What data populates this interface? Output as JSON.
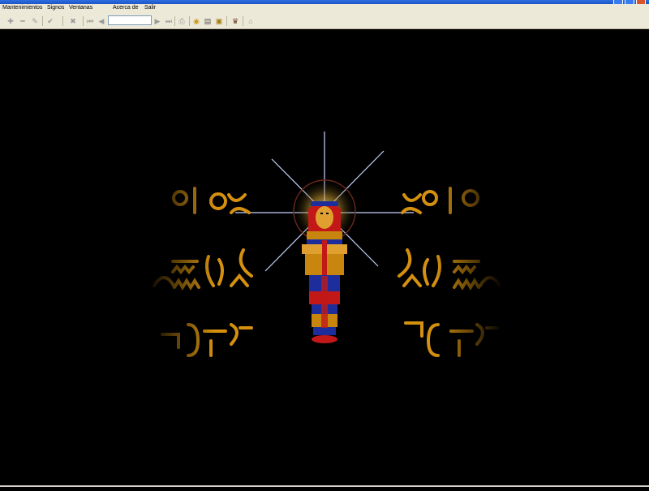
{
  "window": {
    "title": ""
  },
  "menu": {
    "items": [
      "Mantenimientos",
      "Signos",
      "Ventanas",
      "Acerca de",
      "Salir"
    ]
  },
  "toolbar": {
    "buttons": [
      {
        "icon": "add-icon",
        "glyph": "✚"
      },
      {
        "icon": "remove-icon",
        "glyph": "━"
      },
      {
        "icon": "edit-pencil-icon",
        "glyph": "✎"
      },
      {
        "icon": "confirm-check-icon",
        "glyph": "✔"
      },
      {
        "icon": "cancel-x-icon",
        "glyph": "✖"
      },
      {
        "icon": "first-record-icon",
        "glyph": "⏮"
      },
      {
        "icon": "previous-record-icon",
        "glyph": "◀"
      },
      {
        "icon": "next-record-icon",
        "glyph": "▶"
      },
      {
        "icon": "last-record-icon",
        "glyph": "⏭"
      },
      {
        "icon": "print-icon",
        "glyph": "⎙"
      },
      {
        "icon": "eye-symbol-icon",
        "glyph": "👁"
      },
      {
        "icon": "document-icon",
        "glyph": "▤"
      },
      {
        "icon": "card-icon",
        "glyph": "▣"
      },
      {
        "icon": "pharaoh-head-icon",
        "glyph": "♛"
      },
      {
        "icon": "exit-door-icon",
        "glyph": "⌂"
      }
    ],
    "search_value": ""
  },
  "scene": {
    "description_icon": "egyptian-sarcophagus-illustration"
  },
  "colors": {
    "background": "#000000",
    "gold": "#c8860f",
    "gold_light": "#f0b020",
    "blue": "#1d2e9c",
    "red": "#c21818",
    "chrome": "#ece9d8"
  }
}
